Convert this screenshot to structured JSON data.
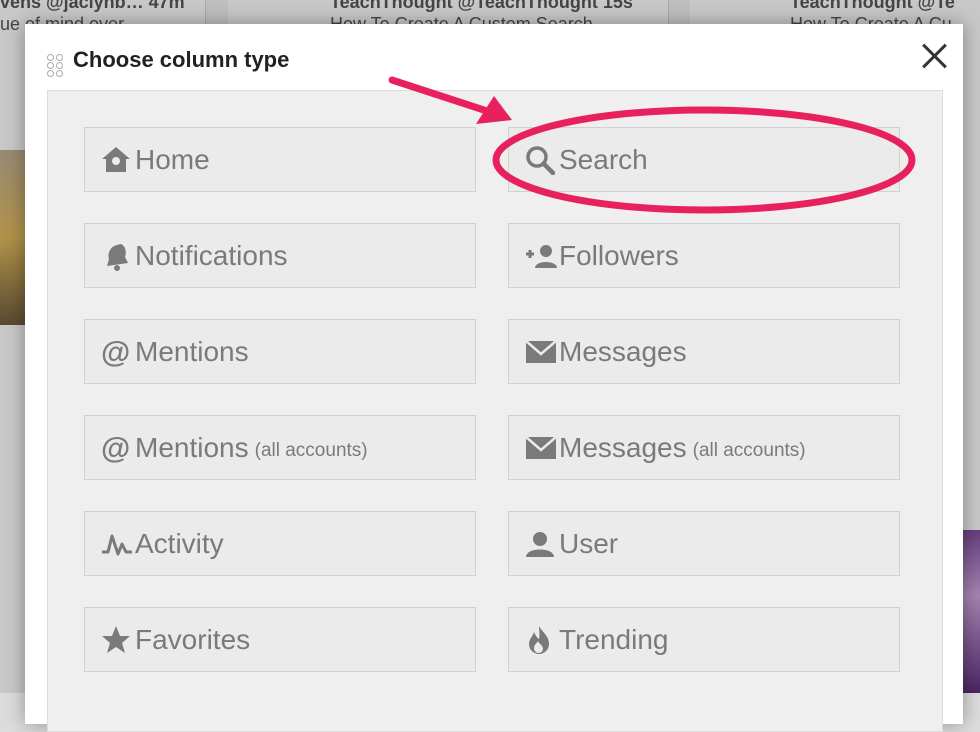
{
  "background": {
    "snippets": [
      {
        "text": "vens @jaclynb…  47m",
        "cls": "bg-text"
      },
      {
        "text": "ue of mind over",
        "cls": "bg-text"
      },
      {
        "text": "TeachThought @TeachThought 15s",
        "cls": "bg-text"
      },
      {
        "text": "How To Create A Custom Search",
        "cls": "bg-text"
      },
      {
        "text": "TeachThought @Te",
        "cls": "bg-text"
      },
      {
        "text": "How To Create A Cu",
        "cls": "bg-text"
      }
    ]
  },
  "modal": {
    "title": "Choose column type",
    "close_label": "×"
  },
  "column_types": [
    {
      "label": "Home",
      "sub": "",
      "icon": "home-icon",
      "name": "home"
    },
    {
      "label": "Search",
      "sub": "",
      "icon": "search-icon",
      "name": "search"
    },
    {
      "label": "Notifications",
      "sub": "",
      "icon": "bell-icon",
      "name": "notifications"
    },
    {
      "label": "Followers",
      "sub": "",
      "icon": "add-follower-icon",
      "name": "followers"
    },
    {
      "label": "Mentions",
      "sub": "",
      "icon": "at-icon",
      "name": "mentions"
    },
    {
      "label": "Messages",
      "sub": "",
      "icon": "envelope-icon",
      "name": "messages"
    },
    {
      "label": "Mentions",
      "sub": "(all accounts)",
      "icon": "at-icon",
      "name": "mentions-all"
    },
    {
      "label": "Messages",
      "sub": "(all accounts)",
      "icon": "envelope-icon",
      "name": "messages-all"
    },
    {
      "label": "Activity",
      "sub": "",
      "icon": "activity-icon",
      "name": "activity"
    },
    {
      "label": "User",
      "sub": "",
      "icon": "user-icon",
      "name": "user"
    },
    {
      "label": "Favorites",
      "sub": "",
      "icon": "star-icon",
      "name": "favorites"
    },
    {
      "label": "Trending",
      "sub": "",
      "icon": "flame-icon",
      "name": "trending"
    }
  ],
  "colors": {
    "annotation": "#e8215e",
    "button_text": "#7a7a7a"
  }
}
